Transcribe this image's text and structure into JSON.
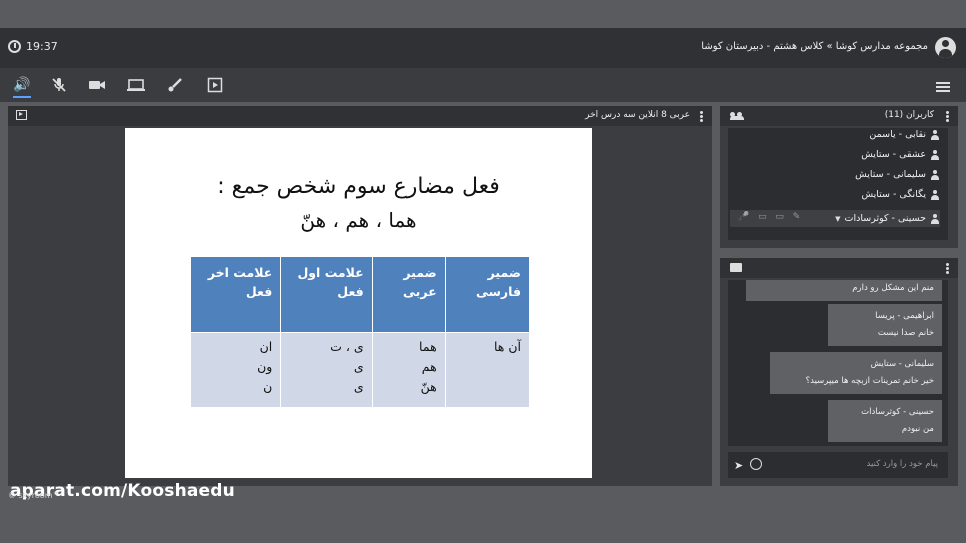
{
  "header": {
    "time": "19:37",
    "title": "مجموعه مدارس کوشا » کلاس هشتم - دبیرستان کوشا"
  },
  "toolbar": {
    "icons": [
      "speaker-icon",
      "mic-muted-icon",
      "camera-icon",
      "screen-share-icon",
      "brush-icon",
      "presentation-icon",
      "menu-icon"
    ]
  },
  "presentation": {
    "title": "عربی 8 انلاین سه درس اخر",
    "slide": {
      "heading": "فعل مضارع سوم شخص جمع :",
      "subheading": "هما ، هم ، هنّ",
      "table": {
        "headers": [
          "ضمیر فارسی",
          "ضمیر عربی",
          "علامت اول فعل",
          "علامت اخر فعل"
        ],
        "row": [
          "آن ها",
          "هما\nهم\nهنّ",
          "ی ، ت\nی\nی",
          "ان\nون\nن"
        ]
      }
    }
  },
  "users_panel": {
    "title": "کاربران (11)",
    "users": [
      "نقابی - یاسمن",
      "عشقی - ستایش",
      "سلیمانی - ستایش",
      "یگانگی - ستایش",
      "حسینی - کوثرسادات"
    ]
  },
  "chat": {
    "messages": [
      {
        "name": "",
        "text": "منم این مشکل رو دارم"
      },
      {
        "name": "ابراهیمی - پریسا",
        "text": "خانم صدا نیست"
      },
      {
        "name": "سلیمانی - ستایش",
        "text": "خیر خانم تمرینات ازبچه ها میپرسید؟"
      },
      {
        "name": "حسینی - کوثرسادات",
        "text": "من نبودم"
      }
    ],
    "placeholder": "پیام خود را وارد کنید"
  },
  "overlay": {
    "watermark": "aparat.com/Kooshaedu",
    "brand": "© skyroom™"
  }
}
